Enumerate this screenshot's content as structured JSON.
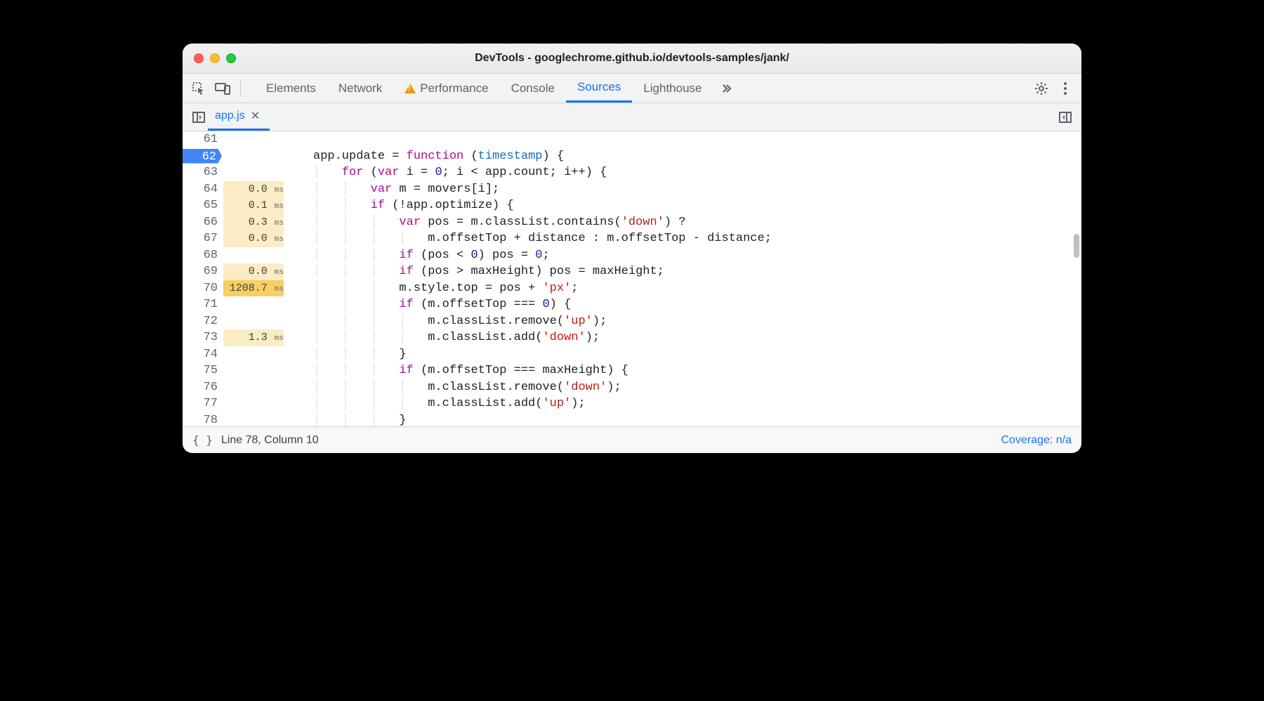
{
  "window": {
    "title": "DevTools - googlechrome.github.io/devtools-samples/jank/"
  },
  "toolbar": {
    "tabs": [
      "Elements",
      "Network",
      "Performance",
      "Console",
      "Sources",
      "Lighthouse"
    ],
    "active": "Sources"
  },
  "subtoolbar": {
    "file_tab": "app.js"
  },
  "gutter": {
    "start": 61,
    "end": 78,
    "breakpoint": 62
  },
  "timings": {
    "64": "0.0",
    "65": "0.1",
    "66": "0.3",
    "67": "0.0",
    "69": "0.0",
    "70": "1208.7",
    "73": "1.3"
  },
  "timing_unit": "ms",
  "code": {
    "61": "",
    "62": {
      "pre": "app.update = ",
      "kw": "function",
      "mid": " (",
      "arg": "timestamp",
      "post": ") {"
    },
    "63": {
      "indent": "    ",
      "kw": "for",
      "mid": " (",
      "kw2": "var",
      "rest": " i = ",
      "num": "0",
      "rest2": "; i < app.count; i++) {"
    },
    "64": {
      "indent": "        ",
      "kw": "var",
      "rest": " m = movers[i];"
    },
    "65": {
      "indent": "        ",
      "kw": "if",
      "rest": " (!app.optimize) {"
    },
    "66": {
      "indent": "            ",
      "kw": "var",
      "rest": " pos = m.classList.contains(",
      "str": "'down'",
      "rest2": ") ?"
    },
    "67": {
      "indent": "                ",
      "rest": "m.offsetTop + distance : m.offsetTop - distance;"
    },
    "68": {
      "indent": "            ",
      "kw": "if",
      "rest": " (pos < ",
      "num": "0",
      "rest2": ") pos = ",
      "num2": "0",
      "rest3": ";"
    },
    "69": {
      "indent": "            ",
      "kw": "if",
      "rest": " (pos > maxHeight) pos = maxHeight;"
    },
    "70": {
      "indent": "            ",
      "rest": "m.style.top = pos + ",
      "str": "'px'",
      "rest2": ";"
    },
    "71": {
      "indent": "            ",
      "kw": "if",
      "rest": " (m.offsetTop === ",
      "num": "0",
      "rest2": ") {"
    },
    "72": {
      "indent": "                ",
      "rest": "m.classList.remove(",
      "str": "'up'",
      "rest2": ");"
    },
    "73": {
      "indent": "                ",
      "rest": "m.classList.add(",
      "str": "'down'",
      "rest2": ");"
    },
    "74": {
      "indent": "            ",
      "rest": "}"
    },
    "75": {
      "indent": "            ",
      "kw": "if",
      "rest": " (m.offsetTop === maxHeight) {"
    },
    "76": {
      "indent": "                ",
      "rest": "m.classList.remove(",
      "str": "'down'",
      "rest2": ");"
    },
    "77": {
      "indent": "                ",
      "rest": "m.classList.add(",
      "str": "'up'",
      "rest2": ");"
    },
    "78": {
      "indent": "            ",
      "rest": "}"
    }
  },
  "statusbar": {
    "position": "Line 78, Column 10",
    "coverage": "Coverage: n/a"
  }
}
